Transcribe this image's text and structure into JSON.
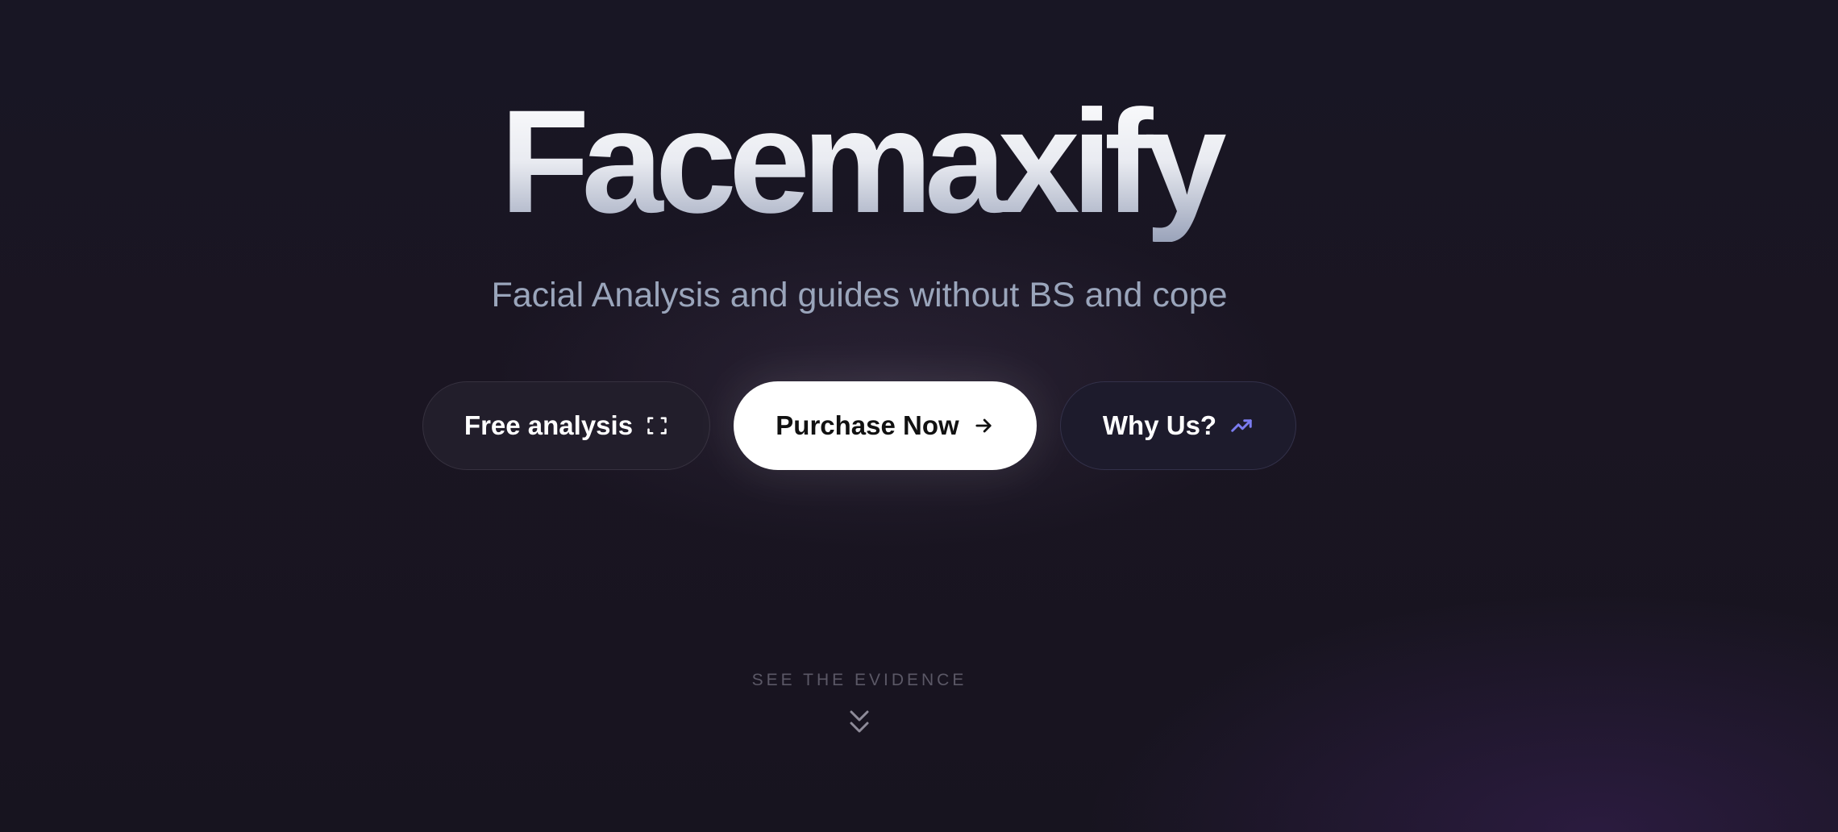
{
  "hero": {
    "title": "Facemaxify",
    "subtitle": "Facial Analysis and guides without BS and cope"
  },
  "buttons": {
    "free_analysis": {
      "label": "Free analysis",
      "icon": "scan-frame-icon"
    },
    "purchase": {
      "label": "Purchase Now",
      "icon": "arrow-right-icon"
    },
    "why_us": {
      "label": "Why Us?",
      "icon": "trending-up-icon"
    }
  },
  "evidence": {
    "label": "SEE THE EVIDENCE",
    "icon": "chevrons-down-icon"
  },
  "colors": {
    "background": "#17141f",
    "accent": "#7b7cf0",
    "subtitle": "#9aa5bb"
  }
}
